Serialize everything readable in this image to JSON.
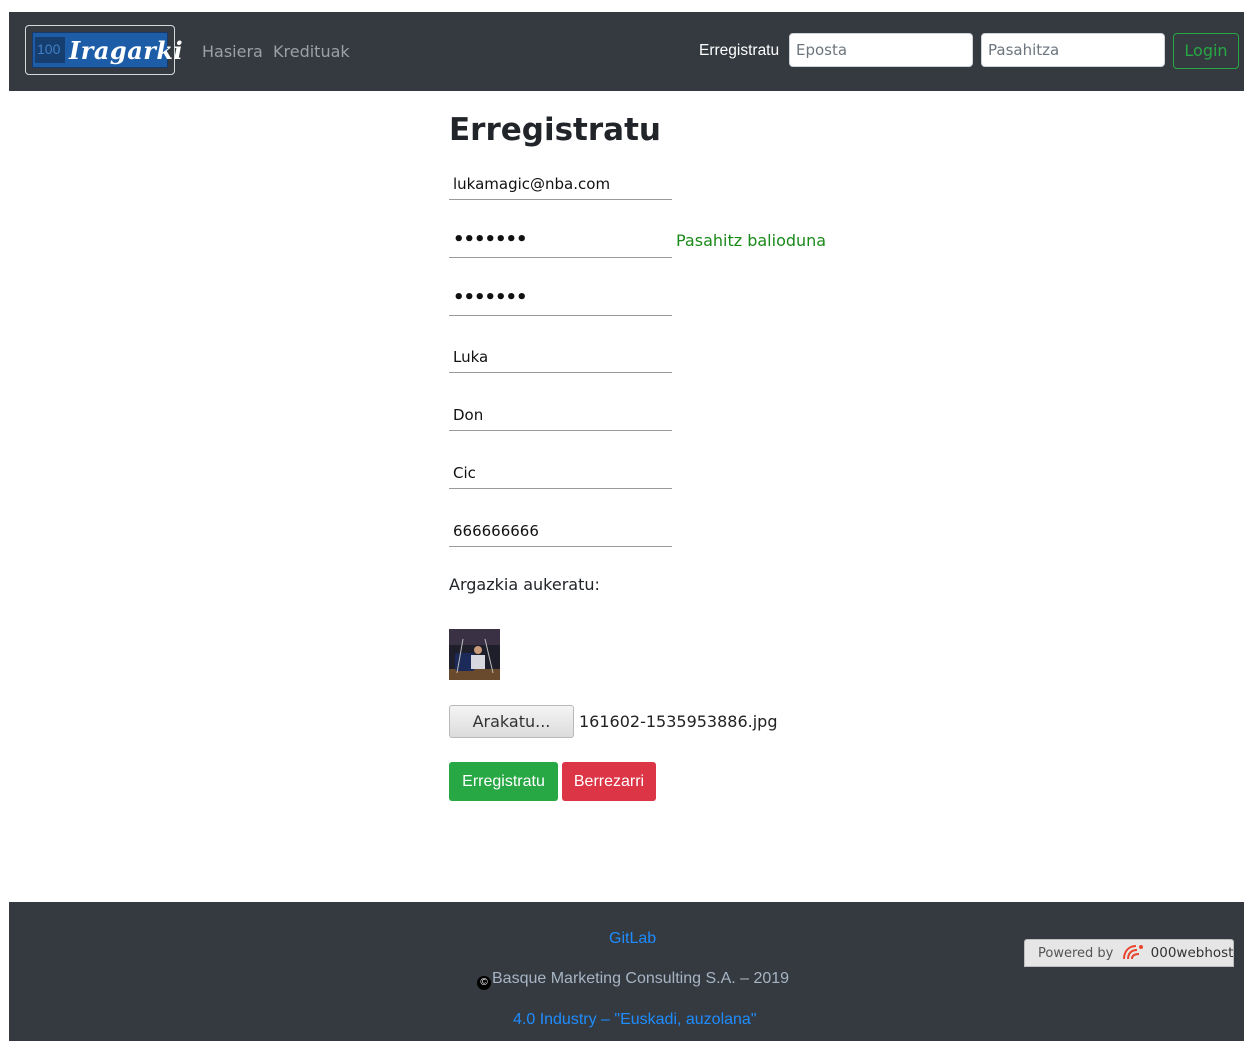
{
  "navbar": {
    "brand_number": "100",
    "brand_name": "Iragarki",
    "links": [
      {
        "label": "Hasiera"
      },
      {
        "label": "Kredituak"
      }
    ],
    "register_label": "Erregistratu",
    "email_placeholder": "Eposta",
    "password_placeholder": "Pasahitza",
    "login_label": "Login",
    "colors": {
      "background": "#343a40",
      "login_accent": "#28a745"
    }
  },
  "form": {
    "title": "Erregistratu",
    "email_value": "lukamagic@nba.com",
    "password_mask": "•••••••",
    "password_valid_message": "Pasahitz balioduna",
    "password_repeat_mask": "•••••••",
    "first_name": "Luka",
    "last_name_1": "Don",
    "last_name_2": "Cic",
    "phone": "666666666",
    "photo_label": "Argazkia aukeratu:",
    "browse_label": "Arakatu...",
    "selected_file": "161602-1535953886.jpg",
    "submit_label": "Erregistratu",
    "reset_label": "Berrezarri",
    "colors": {
      "submit": "#28a745",
      "reset": "#dc3545",
      "valid_text": "#1a8a1a"
    }
  },
  "footer": {
    "gitlab_label": "GitLab",
    "copyright_symbol": "©",
    "copyright_text": "Basque Marketing Consulting S.A. – 2019",
    "industry_text": "4.0 Industry – \"Euskadi, auzolana\"",
    "powered_by_label": "Powered by",
    "powered_by_host": "000webhost",
    "colors": {
      "link": "#1e8cff",
      "text": "#a7b4c4"
    }
  }
}
